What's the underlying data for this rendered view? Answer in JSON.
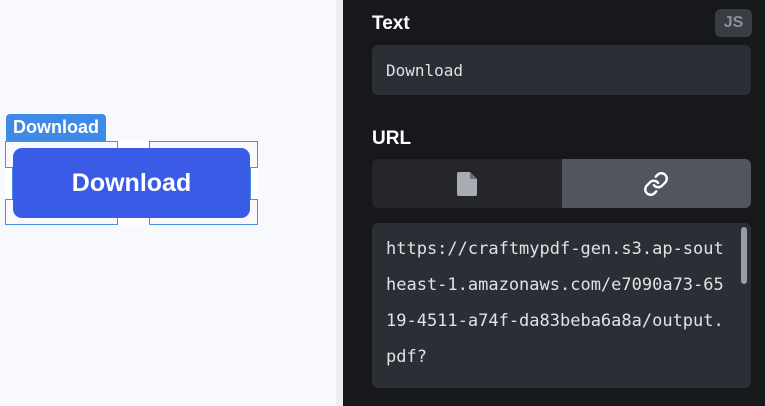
{
  "canvas": {
    "selection_label": "Download",
    "button_label": "Download",
    "button_color": "#3a5be6",
    "selection_color": "#3f8ae6"
  },
  "panel": {
    "text_label": "Text",
    "js_badge": "JS",
    "text_value": "Download",
    "url_label": "URL",
    "source_options": [
      {
        "icon": "file-icon",
        "selected": false
      },
      {
        "icon": "link-icon",
        "selected": true
      }
    ],
    "url_value": "https://craftmypdf-gen.s3.ap-southeast-1.amazonaws.com/e7090a73-6519-4511-a74f-da83beba6a8a/output.pdf?"
  }
}
